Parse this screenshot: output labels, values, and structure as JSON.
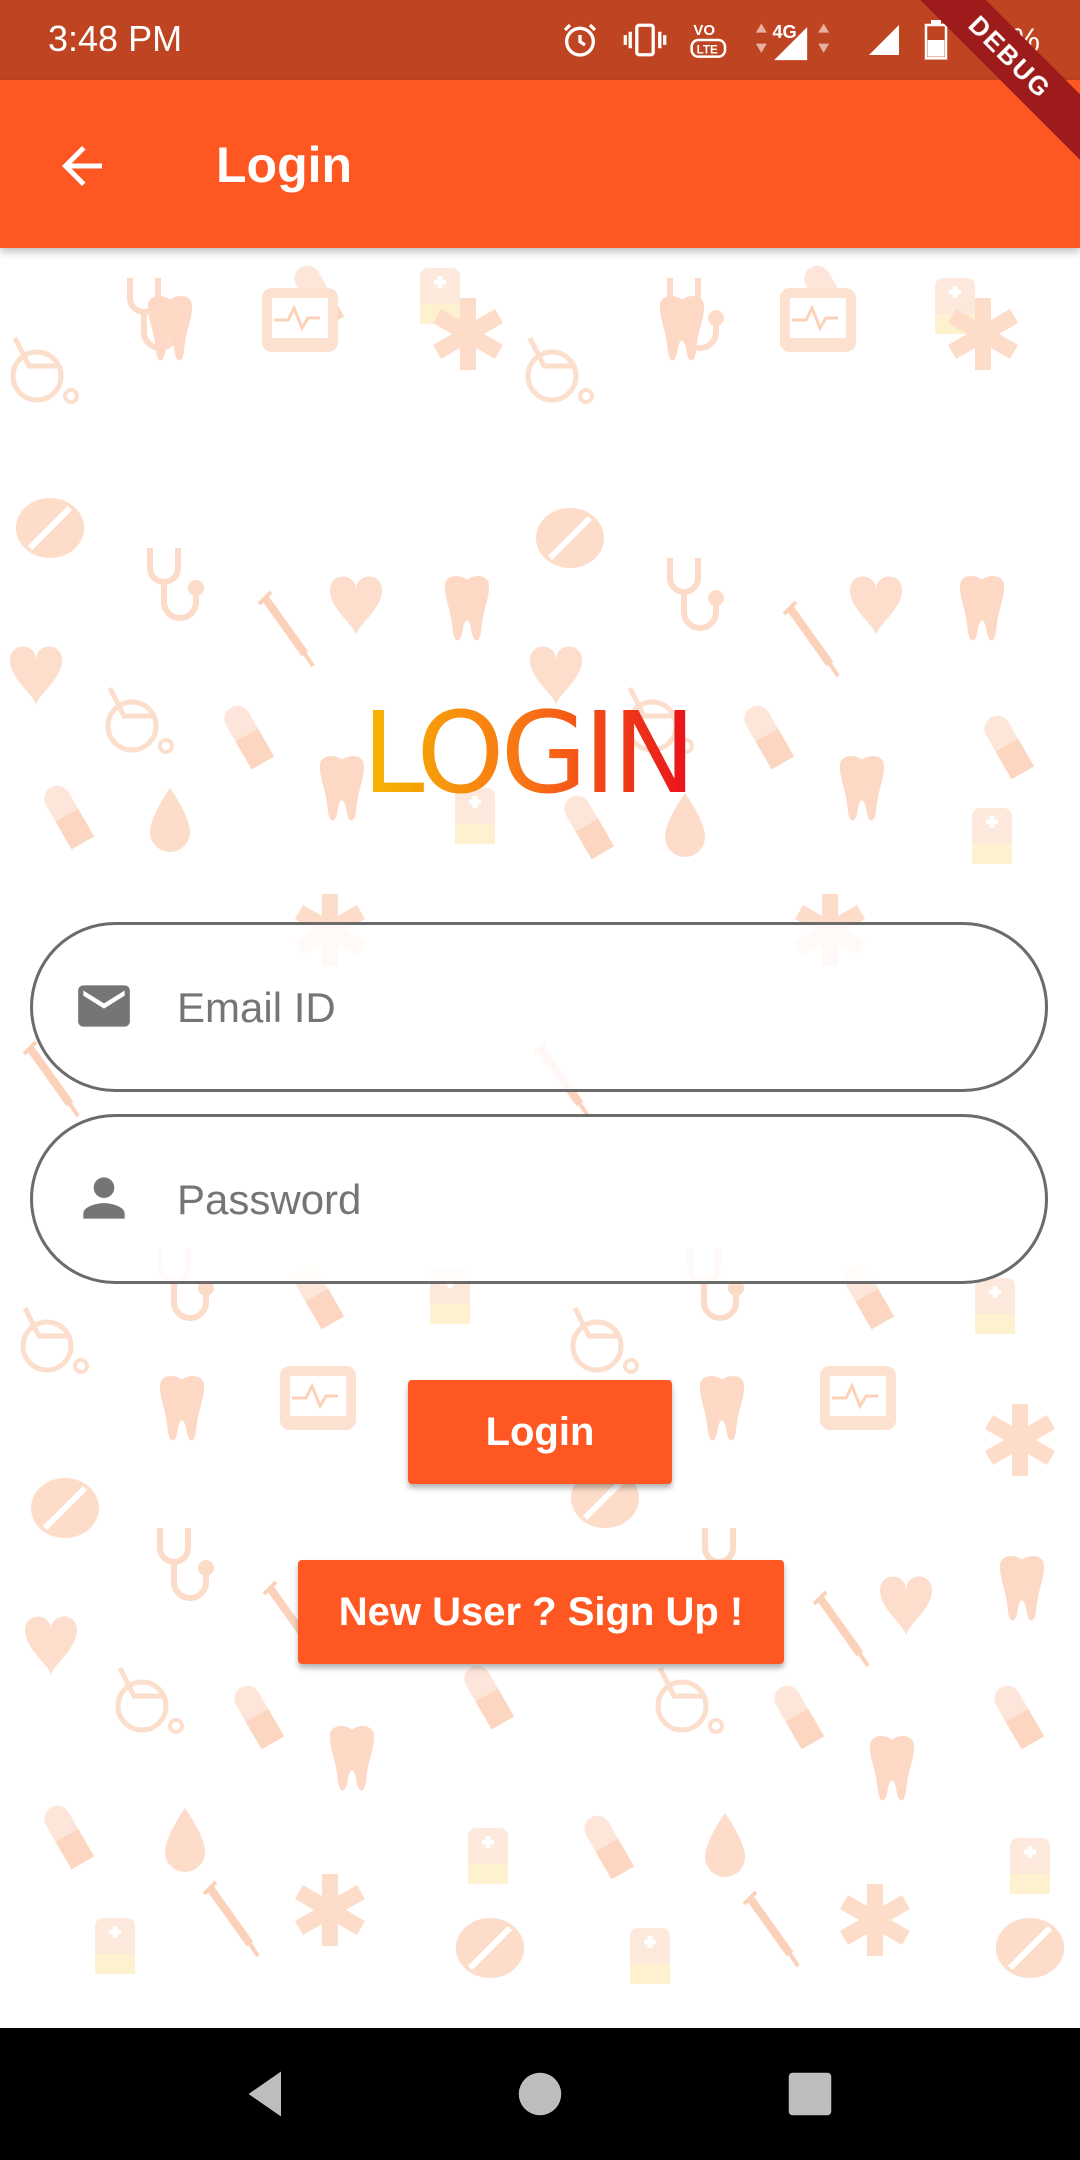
{
  "status_bar": {
    "time": "3:48 PM",
    "battery": "47%",
    "network": "4G",
    "volte": "VoLTE",
    "icons": [
      "alarm-icon",
      "vibrate-icon",
      "volte-icon",
      "4g-signal-icon",
      "signal-icon",
      "battery-icon"
    ]
  },
  "debug_banner": "DEBUG",
  "app_bar": {
    "title": "Login",
    "back_icon": "arrow-back-icon"
  },
  "logo_text": "LOGIN",
  "form": {
    "email": {
      "placeholder": "Email ID",
      "value": "",
      "icon": "email-icon"
    },
    "password": {
      "placeholder": "Password",
      "value": "",
      "icon": "person-icon"
    },
    "login_button": "Login",
    "signup_button": "New User ? Sign Up !"
  },
  "colors": {
    "status_bar": "#BF4421",
    "app_bar": "#FF5722",
    "accent": "#FF5722",
    "logo_gradient": [
      "#F5B800",
      "#F97316",
      "#E8101A"
    ],
    "pattern": "#FDD9C4"
  },
  "nav_bar": {
    "icons": [
      "back-triangle-icon",
      "home-circle-icon",
      "recents-square-icon"
    ]
  }
}
